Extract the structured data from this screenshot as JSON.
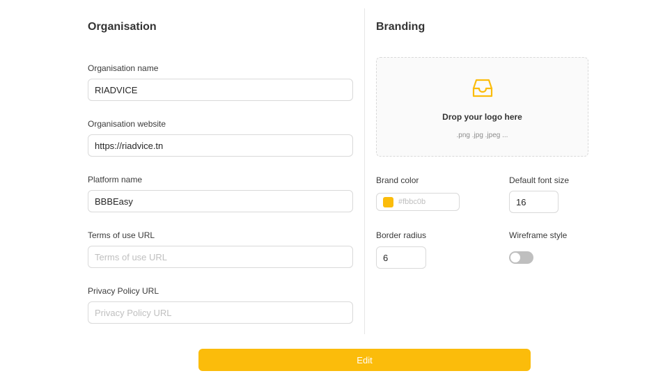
{
  "organisation": {
    "title": "Organisation",
    "fields": [
      {
        "label": "Organisation name",
        "value": "RIADVICE",
        "placeholder": ""
      },
      {
        "label": "Organisation website",
        "value": "https://riadvice.tn",
        "placeholder": ""
      },
      {
        "label": "Platform name",
        "value": "BBBEasy",
        "placeholder": ""
      },
      {
        "label": "Terms of use URL",
        "value": "",
        "placeholder": "Terms of use URL"
      },
      {
        "label": "Privacy Policy URL",
        "value": "",
        "placeholder": "Privacy Policy URL"
      }
    ]
  },
  "branding": {
    "title": "Branding",
    "dropzone": {
      "icon": "inbox-icon",
      "title": "Drop your logo here",
      "hint": ".png .jpg .jpeg ..."
    },
    "brand_color": {
      "label": "Brand color",
      "value": "#fbbc0b"
    },
    "default_font_size": {
      "label": "Default font size",
      "value": "16"
    },
    "border_radius": {
      "label": "Border radius",
      "value": "6"
    },
    "wireframe_style": {
      "label": "Wireframe style",
      "checked": false
    }
  },
  "actions": {
    "edit_label": "Edit"
  },
  "colors": {
    "accent": "#fbbc0b",
    "toggle_off": "#bfbfbf"
  }
}
